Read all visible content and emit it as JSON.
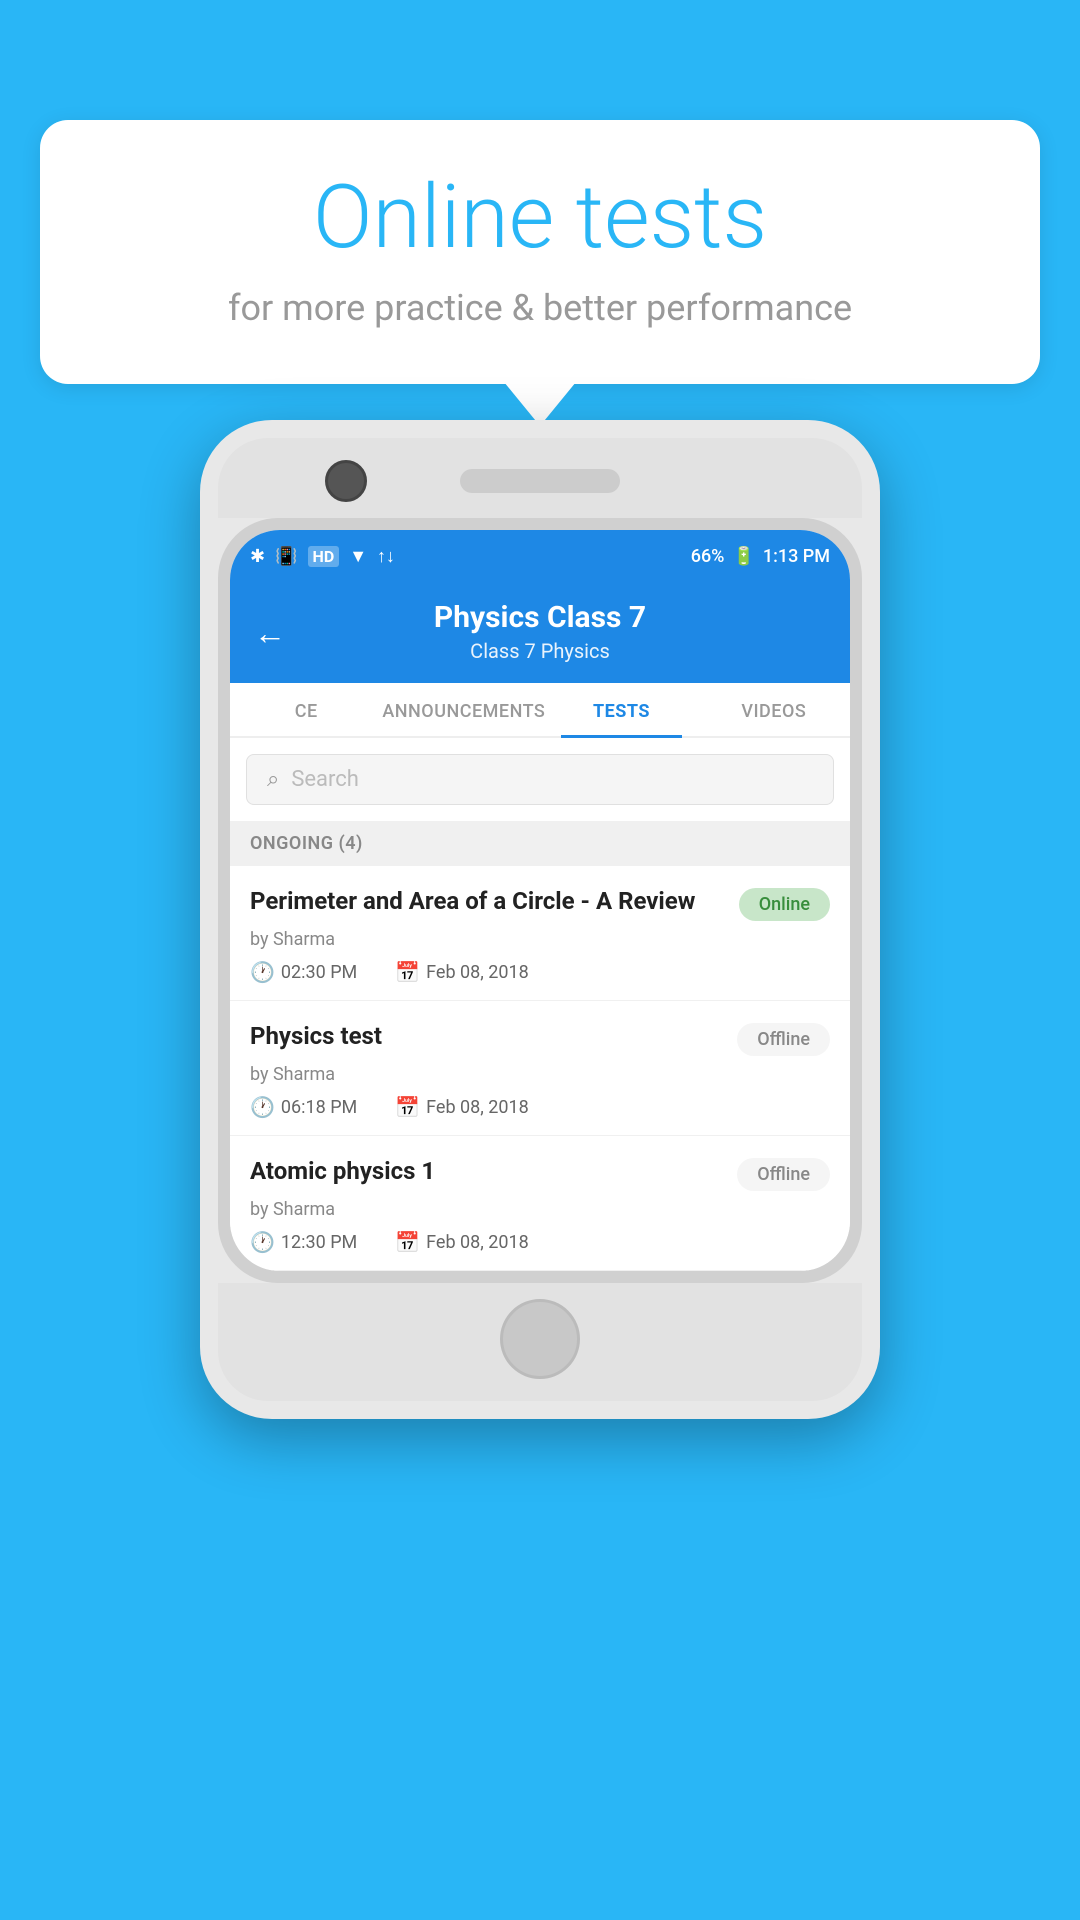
{
  "background_color": "#29b6f6",
  "bubble": {
    "title": "Online tests",
    "subtitle": "for more practice & better performance"
  },
  "status_bar": {
    "time": "1:13 PM",
    "battery": "66%",
    "signal_icons": "❋ 🔔 HD ▼ ✕ ▲"
  },
  "app_bar": {
    "title": "Physics Class 7",
    "subtitle": "Class 7   Physics",
    "back_label": "←"
  },
  "tabs": [
    {
      "label": "CE",
      "active": false
    },
    {
      "label": "ANNOUNCEMENTS",
      "active": false
    },
    {
      "label": "TESTS",
      "active": true
    },
    {
      "label": "VIDEOS",
      "active": false
    }
  ],
  "search": {
    "placeholder": "Search"
  },
  "section": {
    "label": "ONGOING (4)"
  },
  "tests": [
    {
      "name": "Perimeter and Area of a Circle - A Review",
      "author": "by Sharma",
      "time": "02:30 PM",
      "date": "Feb 08, 2018",
      "status": "Online",
      "status_type": "online"
    },
    {
      "name": "Physics test",
      "author": "by Sharma",
      "time": "06:18 PM",
      "date": "Feb 08, 2018",
      "status": "Offline",
      "status_type": "offline"
    },
    {
      "name": "Atomic physics 1",
      "author": "by Sharma",
      "time": "12:30 PM",
      "date": "Feb 08, 2018",
      "status": "Offline",
      "status_type": "offline"
    }
  ]
}
